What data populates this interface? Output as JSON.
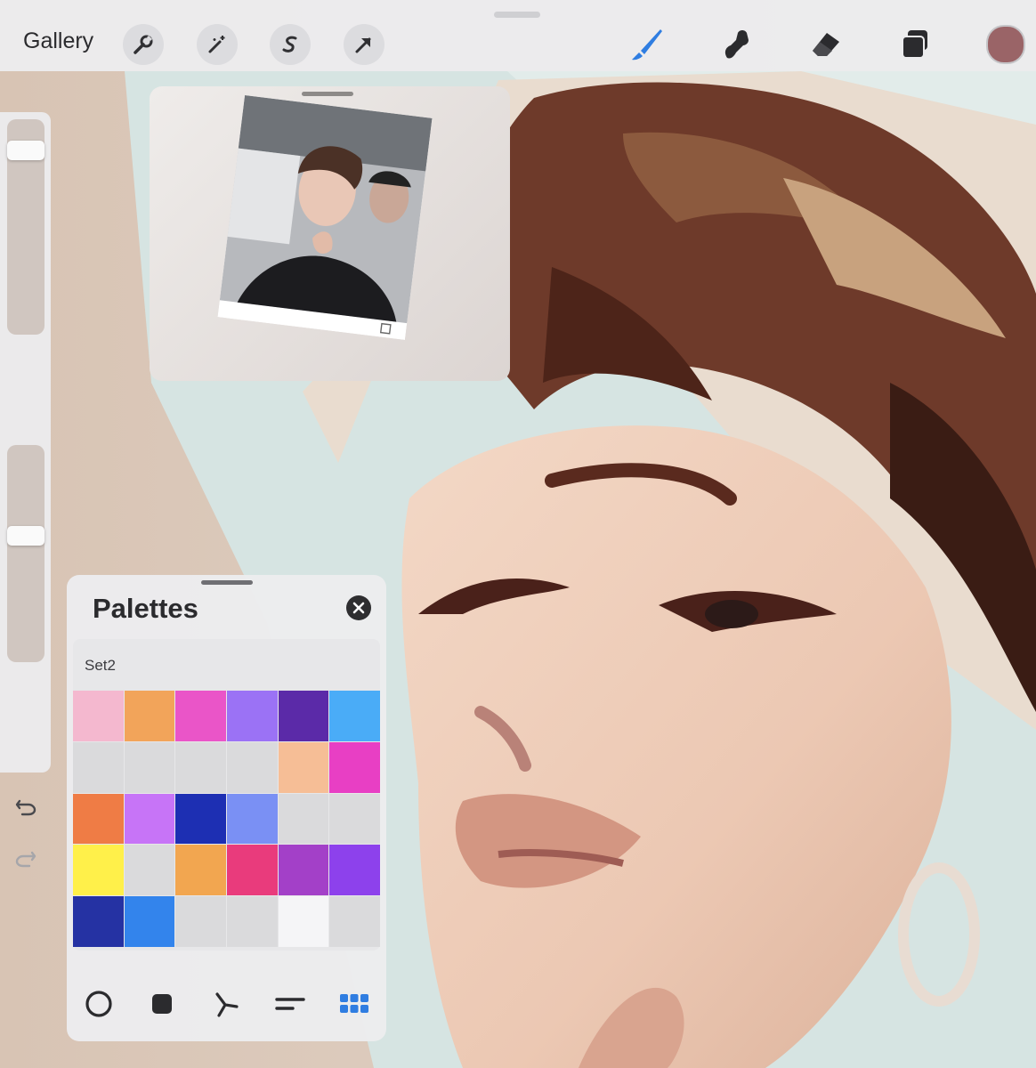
{
  "topbar": {
    "gallery_label": "Gallery",
    "left_tools": [
      "wrench-icon",
      "magic-wand-icon",
      "selection-s-icon",
      "transform-arrow-icon"
    ],
    "right_tools": [
      "brush-icon",
      "smudge-icon",
      "eraser-icon",
      "layers-icon"
    ],
    "current_color": "#9a6467",
    "active_tool_color": "#2f7de1"
  },
  "sidebar": {
    "brush_size_level": 0.1,
    "opacity_level": 0.42,
    "undo": "undo-icon",
    "redo": "redo-icon"
  },
  "reference": {
    "image_icon": "reference-photo"
  },
  "palettes": {
    "title": "Palettes",
    "palette_name": "Set2",
    "swatches": [
      [
        "#f4b8cf",
        "#f2a45a",
        "#ea55c8",
        "#9b72f5",
        "#5b2aa8",
        "#4aacf7"
      ],
      [
        "#dadadc",
        "#dadadc",
        "#dadadc",
        "#dadadc",
        "#f6be96",
        "#e83fc4"
      ],
      [
        "#ef7c45",
        "#c774f7",
        "#1d2fb3",
        "#7a90f4",
        "#dadadc",
        "#dadadc"
      ],
      [
        "#fff04a",
        "#dadadc",
        "#f2a650",
        "#e93b7c",
        "#a340c8",
        "#8d41ec"
      ],
      [
        "#2532a3",
        "#3384ec",
        "#dadadc",
        "#dadadc",
        "#f5f5f7",
        "#dadadc"
      ]
    ],
    "footer_icons": [
      "disc-icon",
      "classic-square-icon",
      "harmony-icon",
      "value-sliders-icon",
      "palette-grid-icon"
    ]
  }
}
